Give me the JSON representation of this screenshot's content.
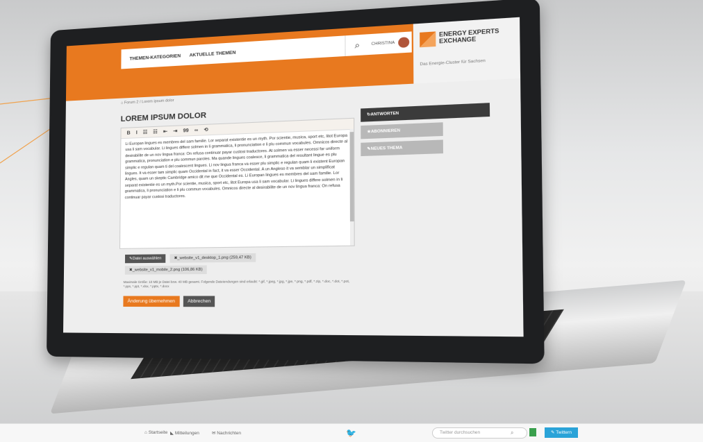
{
  "header": {
    "nav": [
      "THEMEN-KATEGORIEN",
      "AKTUELLE THEMEN"
    ],
    "user": "CHRISTINA",
    "brand_name_1": "ENERGY EXPERTS",
    "brand_name_2": "EXCHANGE",
    "brand_sub": "Das Energie-Cluster für Sachsen"
  },
  "breadcrumb": "Forum 2  /  Lorem ipsum dolor",
  "title": "LOREM IPSUM DOLOR",
  "toolbar": [
    "B",
    "I",
    "☷",
    "☷",
    "⇤",
    "⇥",
    "99",
    "∞",
    "⟲"
  ],
  "editor_text": "Li Europan lingues es membres del sam familie. Lor separat existentie es un myth. Por scientie, musica, sport etc, litot Europa usa li sam vocabular. Li lingues differe solmen in li grammatica, li pronunciation e li plu commun vocabules. Omnicos directe al desirabilite de un nov lingua franca: On refusa continuar payar custosi traductores. At solmen va esser necessi far uniform grammatica, pronunciation e plu sommun paroles. Ma quande lingues coalesce, li grammatica del resultant lingue es plu simplic e regulan quam ti del coalescent lingues. Li nov lingua franca va esser plu simplic e regulan quam li existent Europan lingues. It va esser tam simplic quam Occidental in fact, it va esser Occidental. A un Angleso it va semblar un simplificat Angles, quam un skeptic Cambridge amico dit me que Occidental es. Li Europan lingues es membres del sam familie. Lor separat existentie es un myth.Por scientie, musica, sport etc, litot Europa usa li sam vocabular. Li lingues differe solmen in li grammatica, li pronunciation e li plu commun vocabules. Omnicos directe al desirabilite de un nov lingua franca: On refusa continuar payar custosi traductores.",
  "files": {
    "choose": "Datei auswählen",
    "file1": "_website_v1_desktop_1.png (259,47 KB)",
    "file2": "_website_v1_mobile_2.png (106,86 KB)",
    "limit": "Maximale Größe: 10 MB je Datei bzw. 40 MB gesamt. Folgende Dateiendungen sind erlaubt: *.gif, *.jpeg, *.jpg, *.jpe, *.png, *.pdf, *.zip, *.doc, *.dot, *.pot, *.pps, *.ppt, *.xlsx, *.pptx, *.docx"
  },
  "buttons": {
    "submit": "Änderung übernehmen",
    "cancel": "Abbrechen"
  },
  "side": {
    "answer": "ANTWORTEN",
    "subscribe": "ABONNIEREN",
    "new_topic": "NEUES THEMA"
  },
  "footer": {
    "start": "Startseite",
    "messages": "Mitteilungen",
    "news": "Nachrichten",
    "twitter_placeholder": "Twitter durchsuchen",
    "tweet": "Twittern"
  },
  "colors": {
    "accent": "#e8791f",
    "twitter": "#2aa3d8"
  }
}
